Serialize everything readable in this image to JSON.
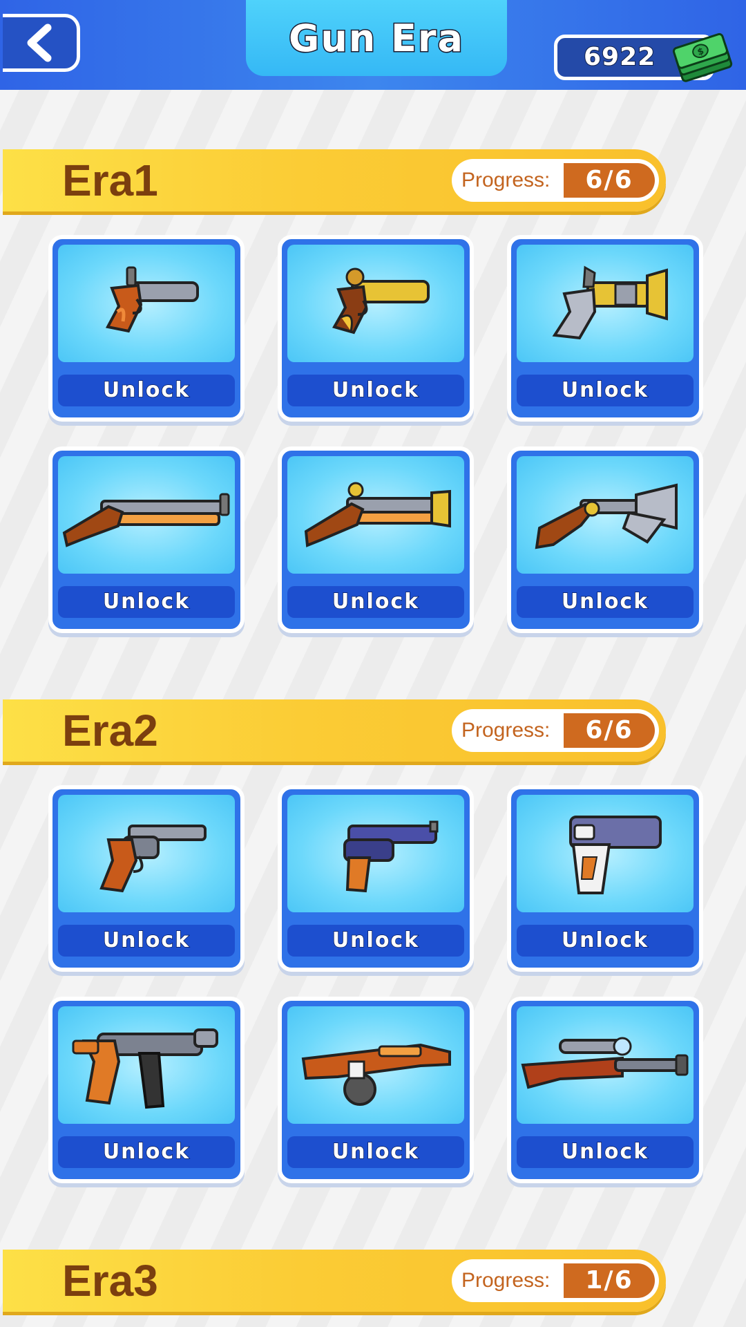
{
  "header": {
    "title": "Gun Era",
    "currency_amount": "6922",
    "back_icon": "chevron-left-icon",
    "currency_icon": "cash-stack-icon"
  },
  "colors": {
    "header_blue": "#2f64e6",
    "banner_yellow": "#fbcc35",
    "era_text_brown": "#7b3f0f",
    "progress_orange": "#cf6a1f",
    "card_blue": "#2f72e8",
    "unlock_blue": "#1d4fcf"
  },
  "progress_label": "Progress:",
  "eras": [
    {
      "title": "Era1",
      "progress": "6/6",
      "cards": [
        {
          "unlock_label": "Unlock",
          "icon": "flintlock-pistol-icon"
        },
        {
          "unlock_label": "Unlock",
          "icon": "gold-flintlock-pistol-icon"
        },
        {
          "unlock_label": "Unlock",
          "icon": "blunderbuss-pistol-icon"
        },
        {
          "unlock_label": "Unlock",
          "icon": "musket-icon"
        },
        {
          "unlock_label": "Unlock",
          "icon": "flintlock-carbine-icon"
        },
        {
          "unlock_label": "Unlock",
          "icon": "dragon-pistol-icon"
        }
      ]
    },
    {
      "title": "Era2",
      "progress": "6/6",
      "cards": [
        {
          "unlock_label": "Unlock",
          "icon": "revolver-icon"
        },
        {
          "unlock_label": "Unlock",
          "icon": "blue-pistol-icon"
        },
        {
          "unlock_label": "Unlock",
          "icon": "semi-auto-pistol-icon"
        },
        {
          "unlock_label": "Unlock",
          "icon": "submachine-gun-icon"
        },
        {
          "unlock_label": "Unlock",
          "icon": "drum-smg-icon"
        },
        {
          "unlock_label": "Unlock",
          "icon": "sniper-rifle-icon"
        }
      ]
    },
    {
      "title": "Era3",
      "progress": "1/6"
    }
  ]
}
